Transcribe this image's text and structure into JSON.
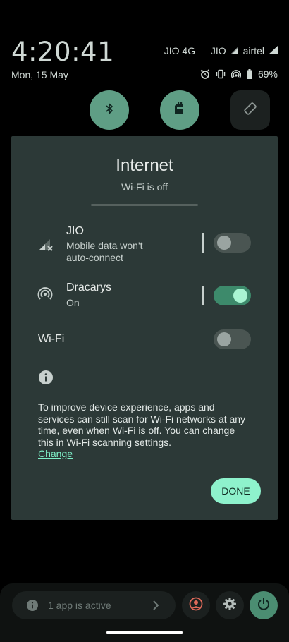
{
  "status_bar": {
    "time": "4:20:41",
    "date": "Mon, 15 May",
    "carrier": "JIO 4G — JIO",
    "carrier2": "airtel",
    "battery": "69%"
  },
  "quick_settings": {
    "tiles": [
      {
        "name": "bluetooth-icon",
        "state": "on"
      },
      {
        "name": "nfc-icon",
        "state": "on"
      },
      {
        "name": "auto-rotate-icon",
        "state": "off"
      }
    ]
  },
  "dialog": {
    "title": "Internet",
    "subtitle": "Wi-Fi is off",
    "networks": [
      {
        "name": "JIO",
        "status_line1": "Mobile data won't",
        "status_line2": "auto-connect",
        "enabled": false,
        "icon": "cellular-signal-icon"
      },
      {
        "name": "Dracarys",
        "status": "On",
        "enabled": true,
        "icon": "hotspot-icon"
      }
    ],
    "wifi": {
      "label": "Wi-Fi",
      "enabled": false
    },
    "info_text": "To improve device experience, apps and services can still scan for Wi-Fi networks at any time, even when Wi-Fi is off. You can change this in Wi-Fi scanning settings.",
    "info_link": "Change",
    "done_label": "DONE"
  },
  "bottom_bar": {
    "active_apps": "1 app is active"
  },
  "colors": {
    "dialog_bg": "#2c3937",
    "accent": "#8ef2cc",
    "tile_on": "#5f9e85"
  }
}
